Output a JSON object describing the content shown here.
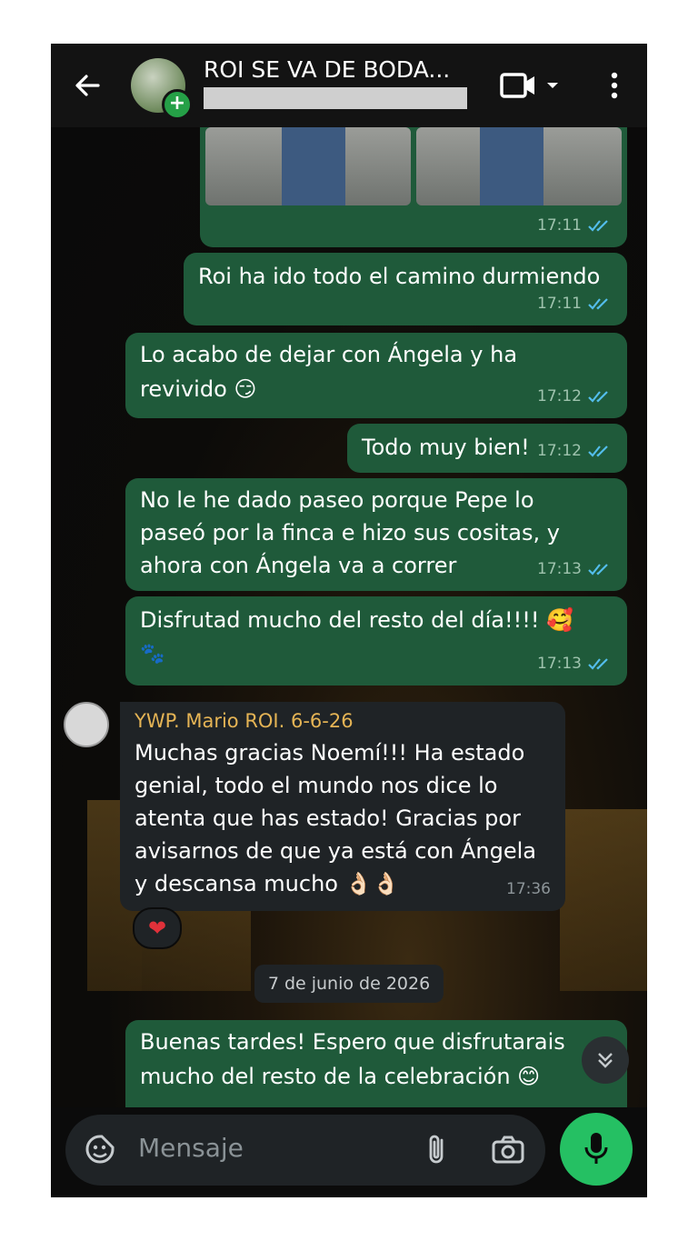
{
  "header": {
    "title": "ROI SE VA DE BODA..."
  },
  "messages": {
    "m1_time": "17:11",
    "m2_text": "Roi ha ido todo el camino durmiendo",
    "m2_time": "17:11",
    "m3_line1": "Lo acabo de dejar con Ángela y ha",
    "m3_line2": "revivido 😏",
    "m3_time": "17:12",
    "m4_text": "Todo muy bien!",
    "m4_time": "17:12",
    "m5_line1": "No le he dado paseo porque Pepe lo",
    "m5_line2": "paseó por la finca e hizo sus cositas, y",
    "m5_line3": "ahora con Ángela va a correr",
    "m5_time": "17:13",
    "m6_line1": "Disfrutad mucho del resto del día!!!! 🥰",
    "m6_line2": "🐾",
    "m6_time": "17:13",
    "m7_sender": "YWP. Mario ROI. 6-6-26",
    "m7_line1": "Muchas gracias Noemí!!! Ha estado",
    "m7_line2": "genial, todo el mundo nos dice lo",
    "m7_line3": "atenta que has estado! Gracias por",
    "m7_line4": "avisarnos de que ya está con Ángela",
    "m7_line5": "y descansa mucho 👌🏻👌🏻",
    "m7_time": "17:36",
    "m7_reaction": "❤",
    "date_separator": "7 de junio de 2026",
    "m8_line1": "Buenas tardes! Espero que disfrutarais",
    "m8_line2": "mucho del resto de la celebración 😊"
  },
  "input": {
    "placeholder": "Mensaje"
  },
  "colors": {
    "outgoing_bubble": "#1f5a3a",
    "incoming_bubble": "#1f2326",
    "accent": "#25c063",
    "sender_name": "#e5b455",
    "read_ticks": "#53bdeb"
  }
}
